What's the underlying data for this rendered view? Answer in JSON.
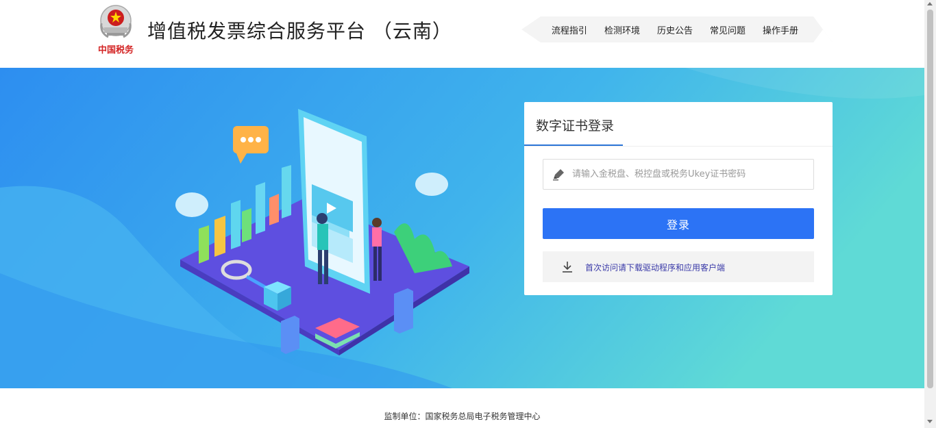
{
  "header": {
    "site_title": "增值税发票综合服务平台 （云南）",
    "logo_caption": "中国税务",
    "nav": [
      {
        "label": "流程指引"
      },
      {
        "label": "检测环境"
      },
      {
        "label": "历史公告"
      },
      {
        "label": "常见问题"
      },
      {
        "label": "操作手册"
      }
    ]
  },
  "login": {
    "title": "数字证书登录",
    "password_placeholder": "请输入金税盘、税控盘或税务Ukey证书密码",
    "password_value": "",
    "login_button": "登录",
    "download_link": "首次访问请下载驱动程序和应用客户端"
  },
  "footer": {
    "text": "监制单位：国家税务总局电子税务管理中心"
  },
  "colors": {
    "primary": "#2c73f5",
    "banner_start": "#2d8ef0",
    "banner_end": "#5fdad6",
    "tab_underline": "#2b74d6"
  },
  "icons": {
    "logo": "tax-emblem-icon",
    "password": "pen-icon",
    "download": "download-arrow-icon"
  }
}
